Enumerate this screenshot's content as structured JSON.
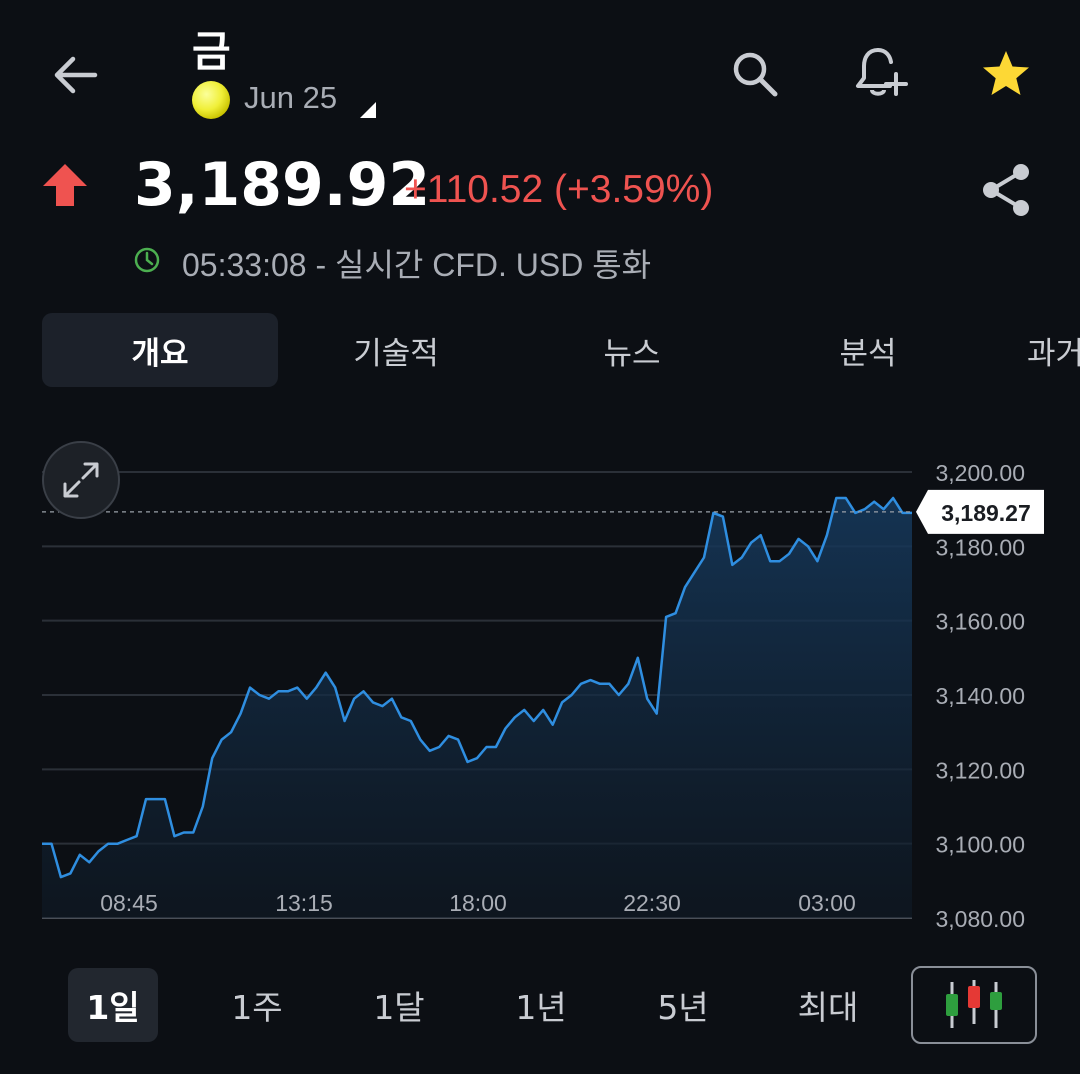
{
  "header": {
    "title": "금",
    "contract": "Jun 25",
    "icons": {
      "back": "back-arrow-icon",
      "search": "search-icon",
      "alert": "add-alert-bell-icon",
      "watchlist": "star-icon"
    },
    "star_color": "#fdd835"
  },
  "quote": {
    "price": "3,189.92",
    "change": "+110.52 (+3.59%)",
    "direction": "up",
    "up_color": "#ef5350",
    "realtime_info": "05:33:08 - 실시간 CFD. USD 통화",
    "clock_color": "#4caf50"
  },
  "tabs": [
    {
      "label": "개요",
      "active": true
    },
    {
      "label": "기술적",
      "active": false
    },
    {
      "label": "뉴스",
      "active": false
    },
    {
      "label": "분석",
      "active": false
    },
    {
      "label": "과거",
      "active": false
    }
  ],
  "chart_data": {
    "type": "area",
    "line_color": "#2f8ee0",
    "x_tick_labels": [
      "08:45",
      "13:15",
      "18:00",
      "22:30",
      "03:00"
    ],
    "y_tick_labels": [
      "3,200.00",
      "3,180.00",
      "3,160.00",
      "3,140.00",
      "3,120.00",
      "3,100.00",
      "3,080.00"
    ],
    "ylim": [
      3080,
      3200
    ],
    "current_value": 3189.27,
    "current_value_label": "3,189.27",
    "grid": true,
    "values": [
      3100,
      3100,
      3091,
      3092,
      3097,
      3095,
      3098,
      3100,
      3100,
      3101,
      3102,
      3112,
      3112,
      3112,
      3102,
      3103,
      3103,
      3110,
      3123,
      3128,
      3130,
      3135,
      3142,
      3140,
      3139,
      3141,
      3141,
      3142,
      3139,
      3142,
      3146,
      3142,
      3133,
      3139,
      3141,
      3138,
      3137,
      3139,
      3134,
      3133,
      3128,
      3125,
      3126,
      3129,
      3128,
      3122,
      3123,
      3126,
      3126,
      3131,
      3134,
      3136,
      3133,
      3136,
      3132,
      3138,
      3140,
      3143,
      3144,
      3143,
      3143,
      3140,
      3143,
      3150,
      3139,
      3135,
      3161,
      3162,
      3169,
      3173,
      3177,
      3189,
      3188,
      3175,
      3177,
      3181,
      3183,
      3176,
      3176,
      3178,
      3182,
      3180,
      3176,
      3183,
      3193,
      3193,
      3189,
      3190,
      3192,
      3190,
      3193,
      3189,
      3189
    ]
  },
  "ranges": [
    {
      "label": "1일",
      "active": true
    },
    {
      "label": "1주",
      "active": false
    },
    {
      "label": "1달",
      "active": false
    },
    {
      "label": "1년",
      "active": false
    },
    {
      "label": "5년",
      "active": false
    },
    {
      "label": "최대",
      "active": false
    }
  ],
  "chart_type_icon": "candlestick-chart-icon",
  "candle_colors": {
    "up": "#2e9e3e",
    "down": "#e53935"
  }
}
